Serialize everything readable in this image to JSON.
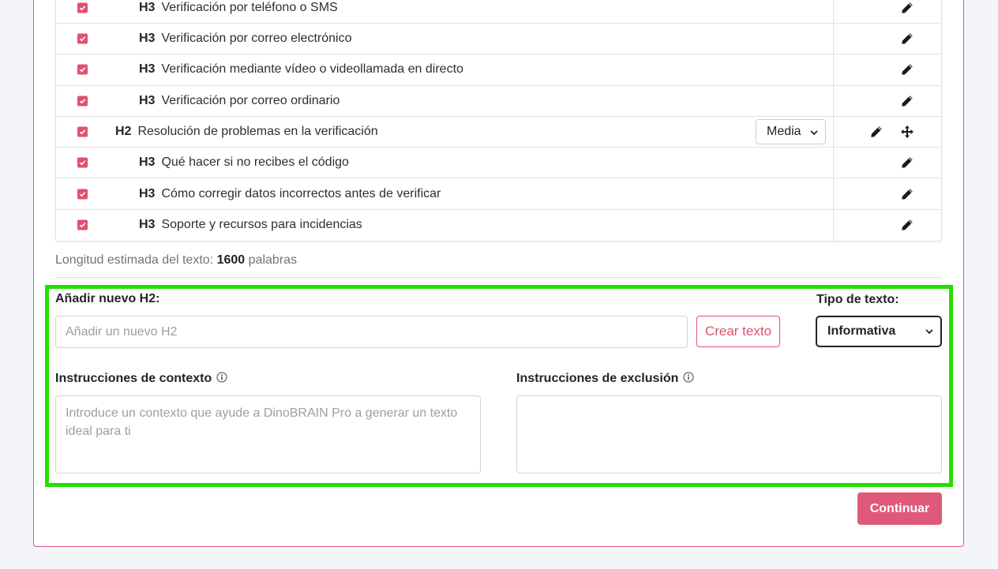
{
  "outline": {
    "rows": [
      {
        "level": "H3",
        "text": "Verificación por teléfono o SMS"
      },
      {
        "level": "H3",
        "text": "Verificación por correo electrónico"
      },
      {
        "level": "H3",
        "text": "Verificación mediante vídeo o videollamada en directo"
      },
      {
        "level": "H3",
        "text": "Verificación por correo ordinario"
      },
      {
        "level": "H2",
        "text": "Resolución de problemas en la verificación",
        "priority": "Media"
      },
      {
        "level": "H3",
        "text": "Qué hacer si no recibes el código"
      },
      {
        "level": "H3",
        "text": "Cómo corregir datos incorrectos antes de verificar"
      },
      {
        "level": "H3",
        "text": "Soporte y recursos para incidencias"
      }
    ]
  },
  "length": {
    "prefix": "Longitud estimada del texto:",
    "value": "1600",
    "suffix": "palabras"
  },
  "new_h2": {
    "label": "Añadir nuevo H2:",
    "placeholder": "Añadir un nuevo H2",
    "button": "Crear texto"
  },
  "text_type": {
    "label": "Tipo de texto:",
    "selected": "Informativa"
  },
  "context": {
    "label": "Instrucciones de contexto",
    "placeholder": "Introduce un contexto que ayude a DinoBRAIN Pro a generar un texto ideal para ti"
  },
  "exclusion": {
    "label": "Instrucciones de exclusión",
    "placeholder": ""
  },
  "continue_button": "Continuar",
  "colors": {
    "accent": "#e0506f",
    "highlight": "#22e000"
  },
  "icons": [
    "checkbox-checked-icon",
    "pencil-icon",
    "move-icon",
    "chevron-down-icon",
    "info-icon"
  ]
}
